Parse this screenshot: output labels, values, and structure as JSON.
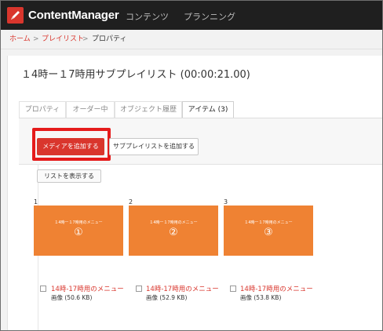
{
  "app": {
    "brand": "ContentManager",
    "nav": [
      "コンテンツ",
      "プランニング"
    ],
    "brand_color": "#d9362d"
  },
  "breadcrumb": {
    "home": "ホーム",
    "sep": ">",
    "playlist": "プレイリスト",
    "current": "プロパティ"
  },
  "page": {
    "title": "１4時ー１7時用サブプレイリスト (00:00:21.00)"
  },
  "tabs": [
    {
      "label": "プロパティ",
      "active": false
    },
    {
      "label": "オーダー中",
      "active": false
    },
    {
      "label": "オブジェクト履歴",
      "active": false
    },
    {
      "label": "アイテム (3)",
      "active": true
    }
  ],
  "toolbar": {
    "add_media": "メディアを追加する",
    "add_subplaylist": "サブプレイリストを追加する",
    "show_list": "リストを表示する"
  },
  "items": [
    {
      "num": "1",
      "thumb_label": "１4時ー１7時用のメニュー",
      "thumb_number": "①",
      "title": "14時-17時用のメニュー",
      "meta": "画像 (50.6 KB)",
      "checked": false
    },
    {
      "num": "2",
      "thumb_label": "１4時ー１7時用のメニュー",
      "thumb_number": "②",
      "title": "14時-17時用のメニュー",
      "meta": "画像 (52.9 KB)",
      "checked": false
    },
    {
      "num": "3",
      "thumb_label": "１4時ー１7時用のメニュー",
      "thumb_number": "③",
      "title": "14時-17時用のメニュー",
      "meta": "画像 (53.8 KB)",
      "checked": false
    }
  ],
  "colors": {
    "thumb": "#ef8233",
    "highlight": "#e51b1b",
    "topbar": "#1f1f1f"
  }
}
